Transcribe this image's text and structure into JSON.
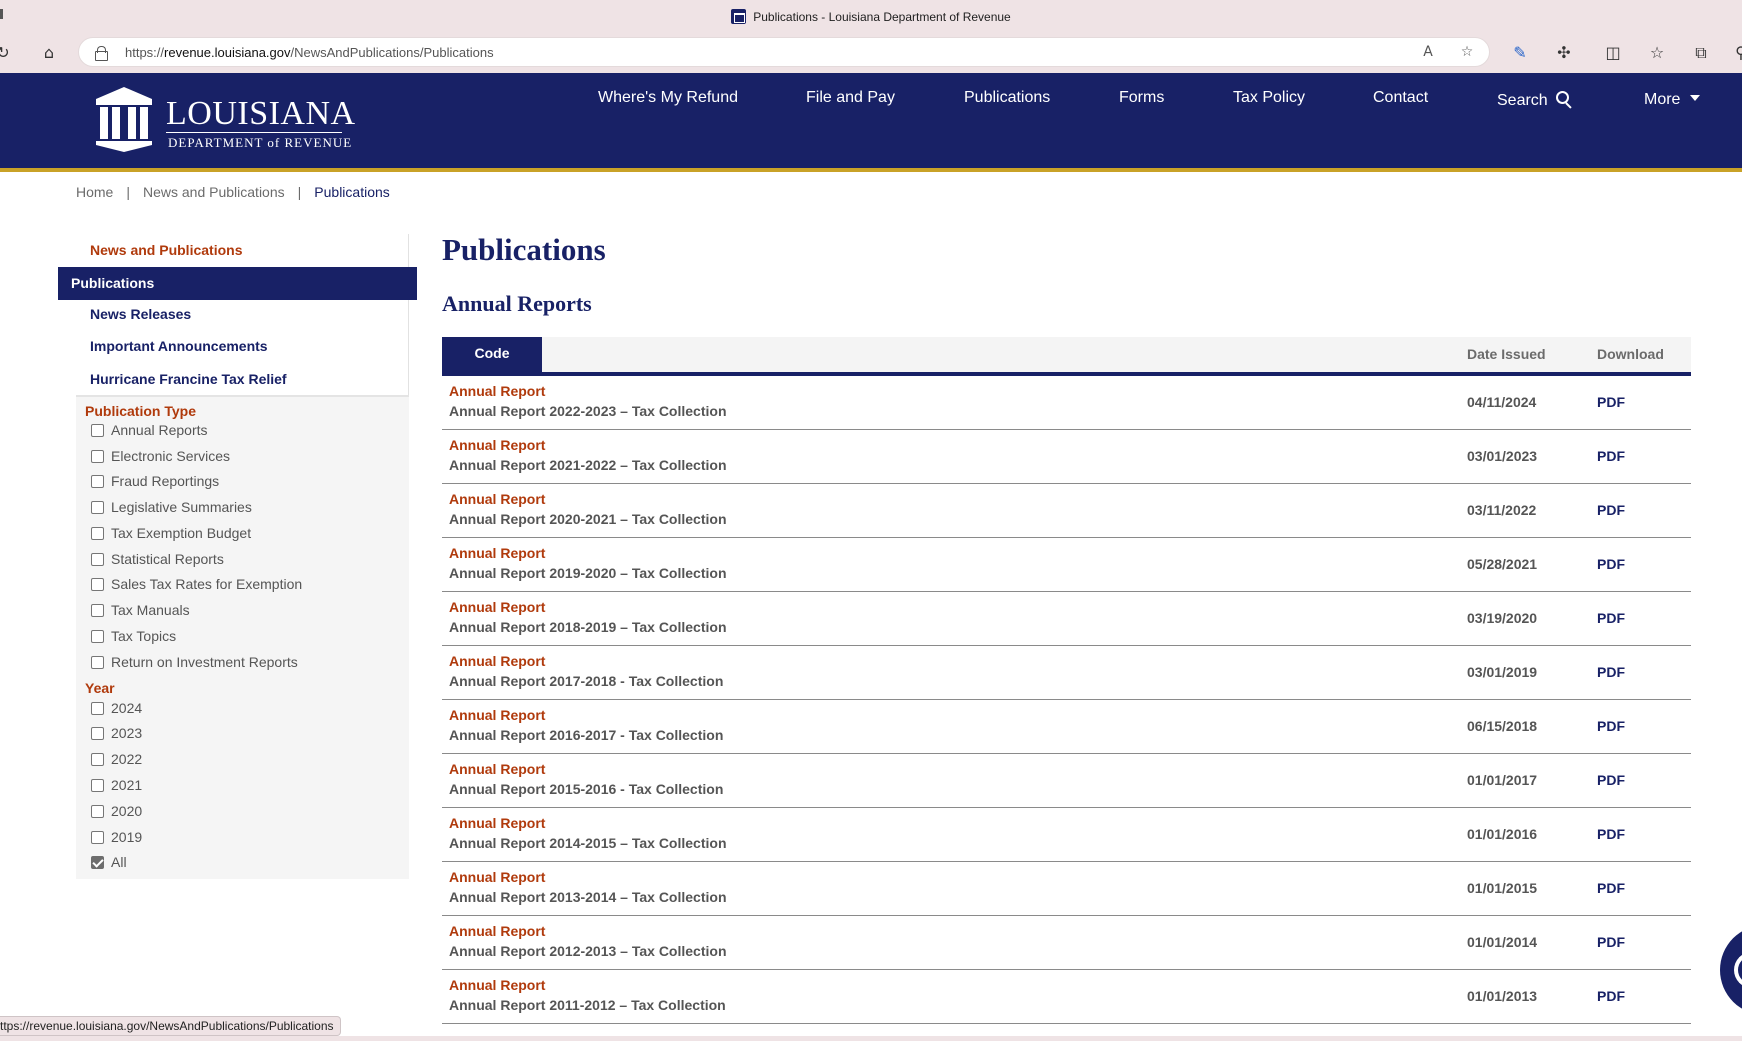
{
  "browser": {
    "tab_title": "Publications - Louisiana Department of Revenue",
    "url_prefix": "https://",
    "url_domain": "revenue.louisiana.gov",
    "url_path": "/NewsAndPublications/Publications",
    "status_url": "ttps://revenue.louisiana.gov/NewsAndPublications/Publications"
  },
  "logo": {
    "line1": "LOUISIANA",
    "line2": "DEPARTMENT of REVENUE"
  },
  "nav": {
    "refund": "Where's My Refund",
    "file_pay": "File and Pay",
    "publications": "Publications",
    "forms": "Forms",
    "tax_policy": "Tax Policy",
    "contact": "Contact",
    "search": "Search",
    "more": "More"
  },
  "breadcrumb": {
    "home": "Home",
    "sep": "|",
    "news": "News and Publications",
    "current": "Publications"
  },
  "sidebar": {
    "parent": "News and Publications",
    "active": "Publications",
    "items": [
      "News Releases",
      "Important Announcements",
      "Hurricane Francine Tax Relief"
    ],
    "pub_type_heading": "Publication Type",
    "pub_types": [
      "Annual Reports",
      "Electronic Services",
      "Fraud Reportings",
      "Legislative Summaries",
      "Tax Exemption Budget",
      "Statistical Reports",
      "Sales Tax Rates for Exemption",
      "Tax Manuals",
      "Tax Topics",
      "Return on Investment Reports"
    ],
    "year_heading": "Year",
    "years": [
      "2024",
      "2023",
      "2022",
      "2021",
      "2020",
      "2019",
      "All"
    ],
    "years_checked": "All"
  },
  "main": {
    "title": "Publications",
    "section": "Annual Reports",
    "columns": {
      "code": "Code",
      "date": "Date Issued",
      "download": "Download"
    },
    "rows": [
      {
        "type": "Annual Report",
        "title": "Annual Report 2022-2023 – Tax Collection",
        "date": "04/11/2024",
        "link": "PDF"
      },
      {
        "type": "Annual Report",
        "title": "Annual Report 2021-2022 – Tax Collection",
        "date": "03/01/2023",
        "link": "PDF"
      },
      {
        "type": "Annual Report",
        "title": "Annual Report 2020-2021 – Tax Collection",
        "date": "03/11/2022",
        "link": "PDF"
      },
      {
        "type": "Annual Report",
        "title": "Annual Report 2019-2020 – Tax Collection",
        "date": "05/28/2021",
        "link": "PDF"
      },
      {
        "type": "Annual Report",
        "title": "Annual Report 2018-2019 – Tax Collection",
        "date": "03/19/2020",
        "link": "PDF"
      },
      {
        "type": "Annual Report",
        "title": "Annual Report 2017-2018 - Tax Collection",
        "date": "03/01/2019",
        "link": "PDF"
      },
      {
        "type": "Annual Report",
        "title": "Annual Report 2016-2017 - Tax Collection",
        "date": "06/15/2018",
        "link": "PDF"
      },
      {
        "type": "Annual Report",
        "title": "Annual Report 2015-2016 - Tax Collection",
        "date": "01/01/2017",
        "link": "PDF"
      },
      {
        "type": "Annual Report",
        "title": "Annual Report 2014-2015 – Tax Collection",
        "date": "01/01/2016",
        "link": "PDF"
      },
      {
        "type": "Annual Report",
        "title": "Annual Report 2013-2014 – Tax Collection",
        "date": "01/01/2015",
        "link": "PDF"
      },
      {
        "type": "Annual Report",
        "title": "Annual Report 2012-2013 – Tax Collection",
        "date": "01/01/2014",
        "link": "PDF"
      },
      {
        "type": "Annual Report",
        "title": "Annual Report 2011-2012 – Tax Collection",
        "date": "01/01/2013",
        "link": "PDF"
      }
    ]
  },
  "colors": {
    "brand_navy": "#182166",
    "accent_orange": "#b03a0c",
    "gold": "#c9a227"
  }
}
